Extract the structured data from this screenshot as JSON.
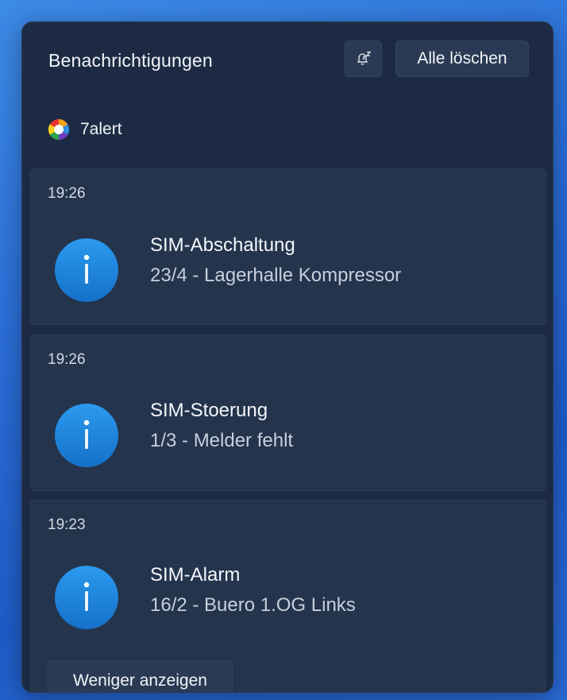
{
  "header": {
    "title": "Benachrichtigungen",
    "snooze_icon": "snooze-bell-icon",
    "clear_all_label": "Alle löschen"
  },
  "app": {
    "name": "7alert",
    "logo_icon": "7alert-logo-icon"
  },
  "notifications": [
    {
      "time": "19:26",
      "title": "SIM-Abschaltung",
      "body": "23/4 - Lagerhalle Kompressor",
      "icon": "info-icon"
    },
    {
      "time": "19:26",
      "title": "SIM-Stoerung",
      "body": "1/3 - Melder fehlt",
      "icon": "info-icon"
    },
    {
      "time": "19:23",
      "title": "SIM-Alarm",
      "body": "16/2 - Buero 1.OG Links",
      "icon": "info-icon"
    }
  ],
  "footer": {
    "show_less_label": "Weniger anzeigen"
  },
  "colors": {
    "panel_background": "#1c2b43",
    "card_background": "#24344d",
    "info_icon": "#1f87dc",
    "desktop_background": "#2c6fd8"
  }
}
